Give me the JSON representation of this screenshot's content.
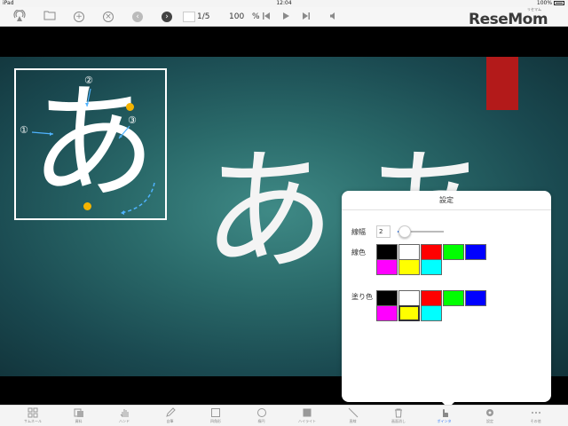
{
  "status_bar": {
    "device": "iPad",
    "time": "12:04",
    "battery": "100%"
  },
  "toolbar": {
    "icons": [
      "airplay-icon",
      "folder-icon",
      "add-icon",
      "close-icon",
      "back-icon",
      "forward-icon"
    ],
    "page_indicator": "1/5",
    "zoom_value": "100",
    "zoom_unit": "%",
    "playback_icons": [
      "skip-start-icon",
      "play-icon",
      "skip-end-icon",
      "volume-icon"
    ]
  },
  "logo": {
    "text": "ReseMom",
    "kana": "リセマム"
  },
  "slide": {
    "main_char": "あ",
    "partial_char": "あ",
    "stroke_numbers": [
      "①",
      "②",
      "③"
    ],
    "colors": {
      "background": "#2a6a6a",
      "accent_red": "#b31a1a",
      "dot": "#f5b400"
    }
  },
  "settings_popover": {
    "title": "設定",
    "line_width_label": "線幅",
    "line_width_value": "2",
    "line_width_level": 0.15,
    "line_color_label": "線色",
    "fill_color_label": "塗り色",
    "line_colors": [
      "#000000",
      "#ffffff",
      "#ff0000",
      "#00ff00",
      "#0000ff",
      "#ff00ff",
      "#ffff00",
      "#00ffff"
    ],
    "fill_colors": [
      "#000000",
      "#ffffff",
      "#ff0000",
      "#00ff00",
      "#0000ff",
      "#ff00ff",
      "#ffff00",
      "#00ffff"
    ],
    "selected_fill_index": 6
  },
  "tab_bar": [
    {
      "label": "サムネール",
      "icon": "grid-icon"
    },
    {
      "label": "資料",
      "icon": "document-icon"
    },
    {
      "label": "ハンド",
      "icon": "hand-icon"
    },
    {
      "label": "自筆",
      "icon": "pencil-icon"
    },
    {
      "label": "四角形",
      "icon": "square-icon"
    },
    {
      "label": "楕円",
      "icon": "circle-icon"
    },
    {
      "label": "ハイライト",
      "icon": "highlight-icon"
    },
    {
      "label": "直線",
      "icon": "line-icon"
    },
    {
      "label": "画面消し",
      "icon": "trash-icon"
    },
    {
      "label": "ポインタ",
      "icon": "pointer-icon",
      "active": true
    },
    {
      "label": "設定",
      "icon": "settings-icon"
    },
    {
      "label": "その他",
      "icon": "more-icon"
    }
  ]
}
